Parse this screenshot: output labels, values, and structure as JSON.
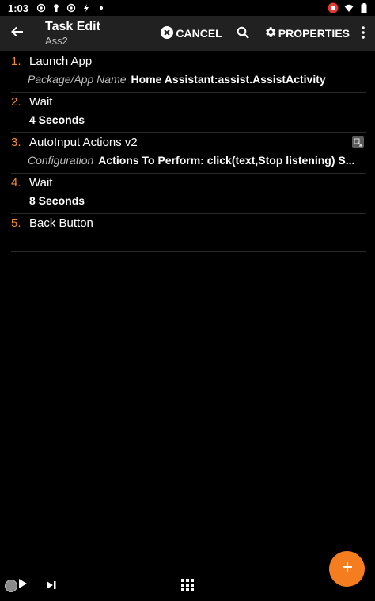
{
  "status_bar": {
    "time": "1:03"
  },
  "app_bar": {
    "title": "Task Edit",
    "subtitle": "Ass2",
    "cancel_label": "CANCEL",
    "properties_label": "PROPERTIES"
  },
  "actions": [
    {
      "number": "1.",
      "name": "Launch App",
      "detail_label": "Package/App Name",
      "detail_value": "Home Assistant:assist.AssistActivity"
    },
    {
      "number": "2.",
      "name": "Wait",
      "detail_value": "4 Seconds"
    },
    {
      "number": "3.",
      "name": "AutoInput Actions v2",
      "detail_label": "Configuration",
      "detail_value": "Actions To Perform: click(text,Stop listening) S..."
    },
    {
      "number": "4.",
      "name": "Wait",
      "detail_value": "8 Seconds"
    },
    {
      "number": "5.",
      "name": "Back Button"
    }
  ],
  "icons": {
    "back": "arrow-left-icon",
    "cancel": "close-circle-icon",
    "search": "search-icon",
    "properties": "gear-icon",
    "more": "more-vertical-icon",
    "fab": "plus-icon",
    "play": "play-icon",
    "step": "skip-next-icon",
    "apps": "grid-icon"
  },
  "colors": {
    "accent": "#f57c1f",
    "number": "#f28b2b",
    "app_bar": "#212121",
    "background": "#000000"
  }
}
